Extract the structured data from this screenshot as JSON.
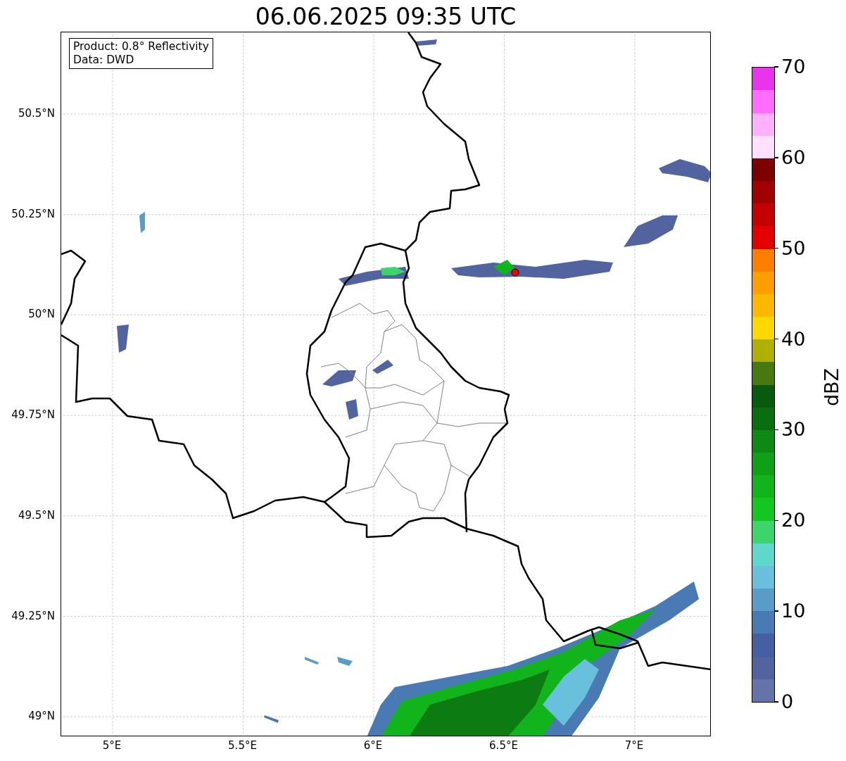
{
  "title": "06.06.2025 09:35 UTC",
  "info_box": {
    "lines": [
      "Product: 0.8° Reflectivity",
      "Data: DWD"
    ]
  },
  "map": {
    "xticks": [
      "5°E",
      "5.5°E",
      "6°E",
      "6.5°E",
      "7°E"
    ],
    "yticks": [
      "50.5°N",
      "50.25°N",
      "50°N",
      "49.75°N",
      "49.5°N",
      "49.25°N",
      "49°N"
    ]
  },
  "colorbar": {
    "label": "dBZ",
    "ticks": [
      "70",
      "60",
      "50",
      "40",
      "30",
      "20",
      "10",
      "0"
    ],
    "bands": [
      {
        "color": "#6474a8"
      },
      {
        "color": "#5264a0"
      },
      {
        "color": "#445fa2"
      },
      {
        "color": "#4a7ab4"
      },
      {
        "color": "#5a9cc8"
      },
      {
        "color": "#68c0dc"
      },
      {
        "color": "#5ed8c8"
      },
      {
        "color": "#3dd46c"
      },
      {
        "color": "#12c820"
      },
      {
        "color": "#12b41c"
      },
      {
        "color": "#10a018"
      },
      {
        "color": "#0e8a14"
      },
      {
        "color": "#0a6e10"
      },
      {
        "color": "#085a0c"
      },
      {
        "color": "#487810"
      },
      {
        "color": "#b0b004"
      },
      {
        "color": "#ffd800"
      },
      {
        "color": "#ffb800"
      },
      {
        "color": "#ff9e00"
      },
      {
        "color": "#ff7e00"
      },
      {
        "color": "#e40000"
      },
      {
        "color": "#c40000"
      },
      {
        "color": "#a00000"
      },
      {
        "color": "#7c0000"
      },
      {
        "color": "#ffe0ff"
      },
      {
        "color": "#ffb0ff"
      },
      {
        "color": "#ff6cff"
      },
      {
        "color": "#e834ec"
      }
    ]
  }
}
